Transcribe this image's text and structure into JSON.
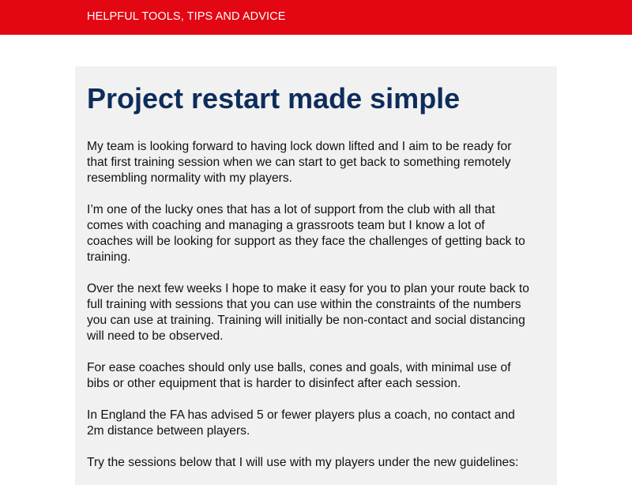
{
  "header": {
    "nav_label": "HELPFUL TOOLS, TIPS AND ADVICE",
    "background_color": "#e30613"
  },
  "article": {
    "title": "Project restart made simple",
    "title_color": "#0d2d5b",
    "paragraphs": [
      {
        "lines": [
          "My team is looking forward to having lock down lifted and I aim to be ready for",
          "that first training session when we can start to get back to something remotely",
          "resembling normality with my players."
        ]
      },
      {
        "lines": [
          "I’m one of the lucky ones that has a lot of support from the club with all that",
          "comes with coaching and managing a grassroots team but I know a lot of",
          "coaches will be looking for support as they face the challenges of getting back to",
          "training."
        ]
      },
      {
        "lines": [
          "Over the next few weeks I hope to make it easy for you to plan your route back to",
          "full training with sessions that you can use within the constraints of the numbers",
          "you can use at training. Training will initially be non-contact and social distancing",
          "will need to be observed."
        ]
      },
      {
        "lines": [
          "For ease coaches should only use balls, cones and goals, with minimal use of",
          "bibs or other equipment that is harder to disinfect after each session."
        ]
      },
      {
        "lines": [
          "In England the FA has advised 5 or fewer players plus a coach, no contact and",
          "2m distance between players."
        ]
      },
      {
        "lines": [
          "Try the sessions below that I will use with my players under the new guidelines:"
        ]
      }
    ]
  }
}
